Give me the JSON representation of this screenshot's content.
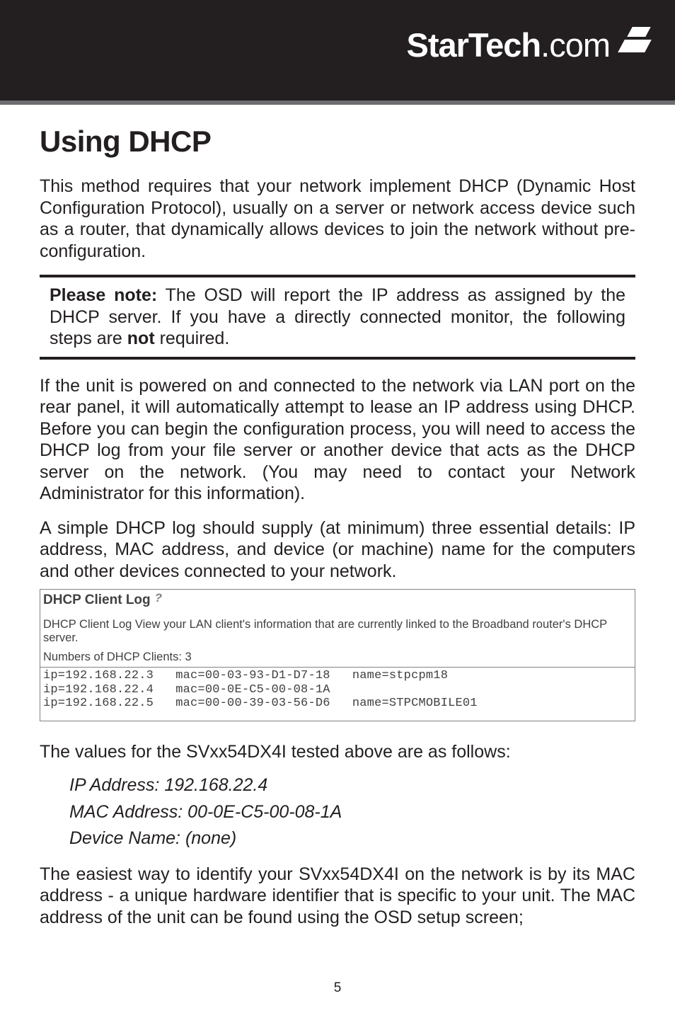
{
  "header": {
    "brand_left": "StarTech",
    "brand_right": ".com"
  },
  "title": "Using DHCP",
  "para1": "This method requires that your network implement DHCP (Dynamic Host Configuration Protocol), usually on a server or network access device such as a router, that dynamically allows devices to join the network without pre-configuration.",
  "note": {
    "lead": "Please note:",
    "body_after_lead": " The OSD will report the IP address as assigned by the DHCP server.  If you have a directly connected monitor, the following steps are ",
    "strong2": "not",
    "tail": " required."
  },
  "para2": "If the unit is powered on and connected to the network via LAN port on the rear panel, it will automatically attempt to lease an IP address using DHCP.  Before you can begin the configuration process, you will need to access the DHCP log from your file server or another device that acts as the DHCP server on the network. (You may need to contact your Network Administrator for this information).",
  "para3": "A simple DHCP log should supply (at minimum) three essential details: IP address, MAC address, and device (or machine) name for the computers and other devices connected to your network.",
  "log": {
    "title": "DHCP Client Log",
    "desc": "DHCP Client Log View your LAN client's information that are currently linked to the Broadband router's DHCP server.",
    "count_label": "Numbers of DHCP Clients: 3",
    "rows": [
      "ip=192.168.22.3   mac=00-03-93-D1-D7-18   name=stpcpm18",
      "ip=192.168.22.4   mac=00-0E-C5-00-08-1A",
      "ip=192.168.22.5   mac=00-00-39-03-56-D6   name=STPCMOBILE01"
    ]
  },
  "para4": "The values for the SVxx54DX4I tested above are as follows:",
  "values": {
    "ip": "IP Address: 192.168.22.4",
    "mac": "MAC Address: 00-0E-C5-00-08-1A",
    "devname": "Device Name: (none)"
  },
  "para5": "The easiest way to identify your SVxx54DX4I on the network is by its MAC address -  a unique hardware identifier that is specific to your unit. The MAC address of the unit can be found using the OSD setup screen;",
  "page_number": "5"
}
